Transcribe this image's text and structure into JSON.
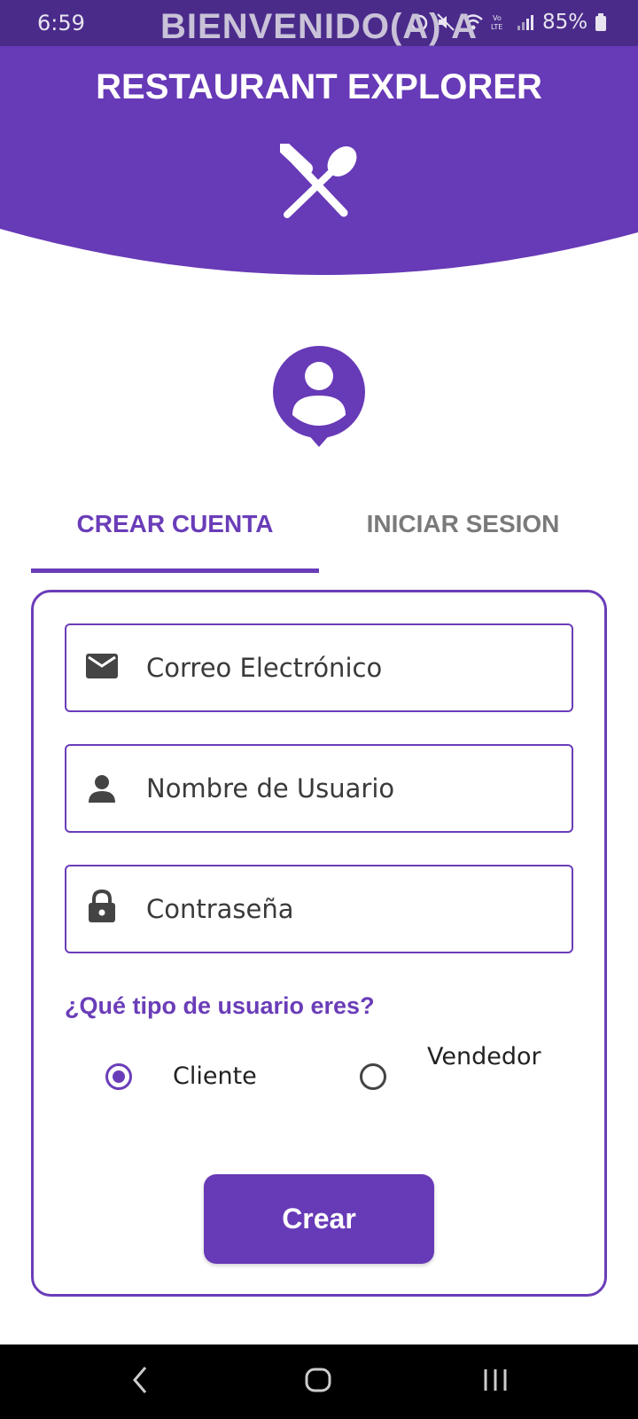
{
  "status_bar": {
    "time": "6:59",
    "battery": "85%",
    "icons": [
      "alarm-icon",
      "mute-icon",
      "wifi-icon",
      "volte-icon",
      "signal-icon",
      "battery-icon"
    ]
  },
  "header": {
    "welcome_line1": "BIENVENIDO(A) A",
    "app_name": "RESTAURANT EXPLORER",
    "logo_icon": "fork-spoon-icon"
  },
  "tabs": [
    {
      "label": "CREAR CUENTA",
      "active": true
    },
    {
      "label": "INICIAR SESION",
      "active": false
    }
  ],
  "form": {
    "email_placeholder": "Correo Electrónico",
    "username_placeholder": "Nombre de Usuario",
    "password_placeholder": "Contraseña",
    "user_type_question": "¿Qué tipo de usuario eres?",
    "user_types": [
      {
        "label": "Cliente",
        "selected": true
      },
      {
        "label": "Vendedor",
        "selected": false
      }
    ],
    "submit_label": "Crear"
  },
  "colors": {
    "primary": "#673ab7",
    "header": "#673ab7",
    "status_bar": "#4a2b8a"
  }
}
